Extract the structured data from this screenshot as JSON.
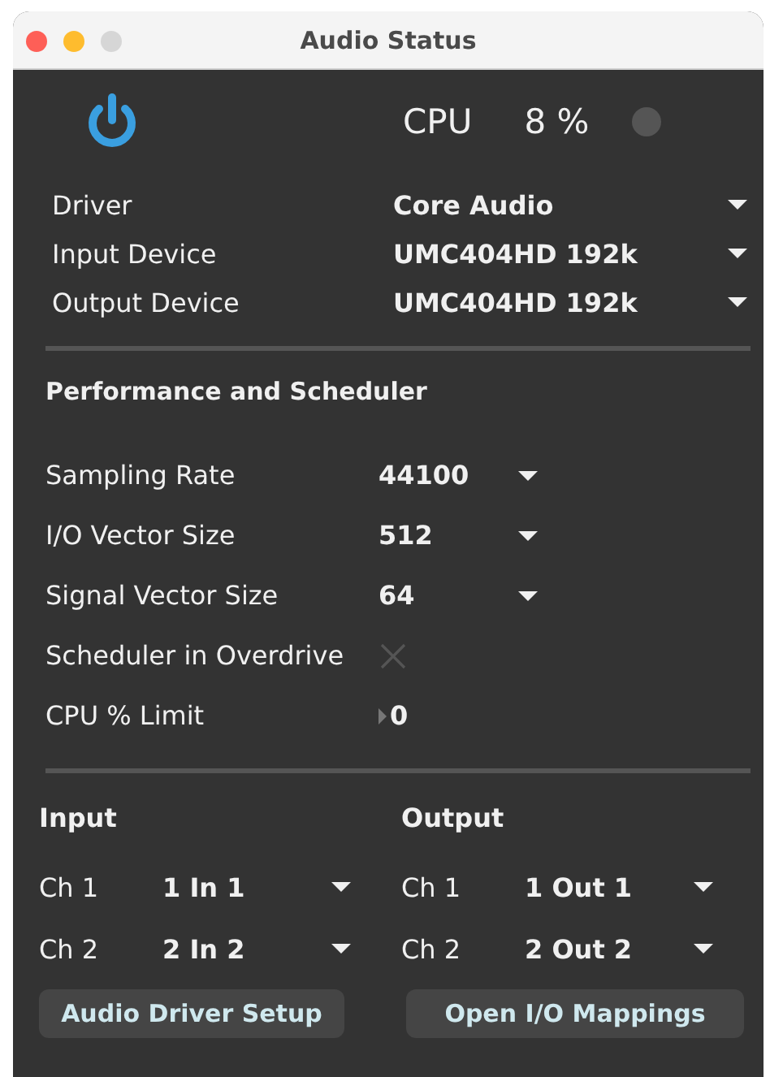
{
  "window": {
    "title": "Audio Status"
  },
  "audio": {
    "on": true,
    "cpu_label": "CPU",
    "cpu_value": "8 %"
  },
  "devices": [
    {
      "label": "Driver",
      "value": "Core Audio"
    },
    {
      "label": "Input Device",
      "value": "UMC404HD 192k"
    },
    {
      "label": "Output Device",
      "value": "UMC404HD 192k"
    }
  ],
  "performance": {
    "heading": "Performance and Scheduler",
    "rows": [
      {
        "kind": "dropdown",
        "label": "Sampling Rate",
        "value": "44100"
      },
      {
        "kind": "dropdown",
        "label": "I/O Vector Size",
        "value": "512"
      },
      {
        "kind": "dropdown",
        "label": "Signal Vector Size",
        "value": "64"
      },
      {
        "kind": "toggle",
        "label": "Scheduler in Overdrive",
        "checked": false
      },
      {
        "kind": "number",
        "label": "CPU % Limit",
        "value": "0"
      }
    ]
  },
  "input": {
    "heading": "Input",
    "channels": [
      {
        "label": "Ch 1",
        "value": "1 In 1"
      },
      {
        "label": "Ch 2",
        "value": "2 In 2"
      }
    ]
  },
  "output": {
    "heading": "Output",
    "channels": [
      {
        "label": "Ch 1",
        "value": "1 Out 1"
      },
      {
        "label": "Ch 2",
        "value": "2 Out 2"
      }
    ]
  },
  "buttons": [
    "Audio Driver Setup",
    "Open I/O Mappings"
  ]
}
